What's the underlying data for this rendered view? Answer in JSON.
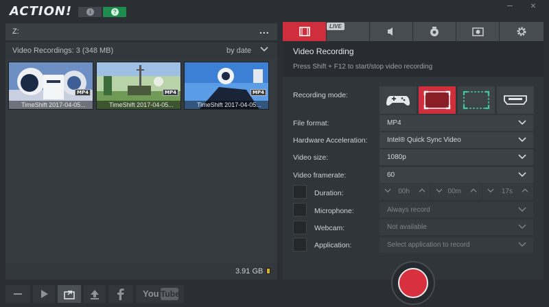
{
  "app": {
    "logo_text": "ACTION!",
    "info_glyph": "i",
    "help_glyph": "?",
    "window_controls": {
      "minimize": "–",
      "close": "×"
    }
  },
  "left": {
    "path": "Z:",
    "path_menu": "...",
    "list_title": "Video Recordings: 3 (348 MB)",
    "sort_label": "by date",
    "thumbnails": [
      {
        "caption": "TimeShift 2017-04-05...",
        "badge": "MP4"
      },
      {
        "caption": "TimeShift 2017-04-05...",
        "badge": "MP4"
      },
      {
        "caption": "TimeShift 2017-04-05...",
        "badge": "MP4"
      }
    ],
    "free_space": "3.91 GB"
  },
  "toolbar": {
    "youtube_you": "You",
    "youtube_tube": "Tube"
  },
  "right": {
    "tabs": [
      "video",
      "live",
      "audio",
      "webcam",
      "screenshot",
      "settings"
    ],
    "live_label": "LIVE",
    "section_title": "Video Recording",
    "section_hint": "Press Shift + F12 to start/stop video recording",
    "labels": {
      "recording_mode": "Recording mode:",
      "file_format": "File format:",
      "hw_accel": "Hardware Acceleration:",
      "video_size": "Video size:",
      "framerate": "Video framerate:",
      "duration": "Duration:",
      "microphone": "Microphone:",
      "webcam": "Webcam:",
      "application": "Application:"
    },
    "values": {
      "file_format": "MP4",
      "hw_accel": "Intel® Quick Sync Video",
      "video_size": "1080p",
      "framerate": "60",
      "duration_h": "00h",
      "duration_m": "00m",
      "duration_s": "17s",
      "microphone": "Always record",
      "webcam": "Not available",
      "application": "Select application to record"
    },
    "recording_mode_selected": "screen-region",
    "accent_color": "#cf2f3c"
  }
}
